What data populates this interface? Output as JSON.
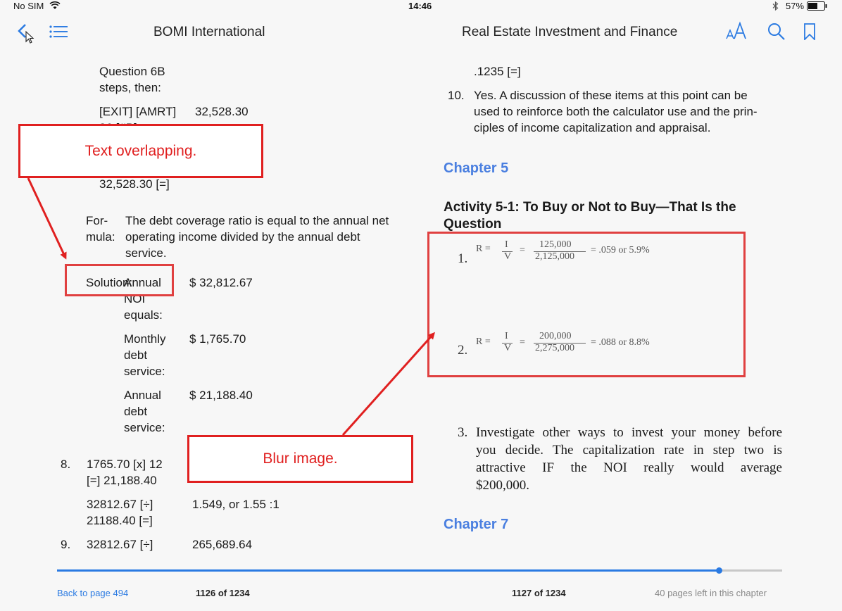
{
  "status_bar": {
    "carrier": "No SIM",
    "time": "14:46",
    "battery": "57%"
  },
  "header": {
    "left_title": "BOMI International",
    "right_title": "Real Estate Investment and Finance"
  },
  "left_page": {
    "q6b_line1": "Question 6B",
    "q6b_line2": "steps, then:",
    "exit_amrt": "[EXIT] [AMRT]",
    "exit_amrt_value": "32,528.30",
    "partial_line": "36 [#P]",
    "result_line": "32,528.30 [=]",
    "formula_label1": "For-",
    "formula_label2": "mula:",
    "formula_text1": "The debt coverage ratio is equal to the annual net",
    "formula_text2": "operating income divided by the annual debt",
    "formula_text3": "service.",
    "solution_label": "Solution:",
    "annual_noi_1": "Annual",
    "annual_noi_2": "NOI",
    "annual_noi_3": "equals:",
    "annual_noi_value": "$ 32,812.67",
    "monthly_1": "Monthly",
    "monthly_2": "debt",
    "monthly_3": "service:",
    "monthly_value": "$ 1,765.70",
    "annual_debt_1": "Annual",
    "annual_debt_2": "debt",
    "annual_debt_3": "service:",
    "annual_debt_value": "$ 21,188.40",
    "item8_num": "8.",
    "item8_line1": "1765.70 [x] 12",
    "item8_line2": "[=] 21,188.40",
    "item8b_line1": "32812.67 [÷]",
    "item8b_line2": "21188.40 [=]",
    "item8b_value": "1.549, or 1.55 :1",
    "item9_num": "9.",
    "item9_line1": "32812.67 [÷]",
    "item9_value": "265,689.64"
  },
  "right_page": {
    "top_line": ".1235 [=]",
    "item10_num": "10.",
    "item10_line1": "Yes. A discussion of these items at this point can be",
    "item10_line2": "used to reinforce both the calculator use and the prin-",
    "item10_line3": "ciples of income capitalization and appraisal.",
    "chapter5": "Chapter 5",
    "activity_line1": "Activity 5-1: To Buy or Not to Buy—That Is the",
    "activity_line2": "Question",
    "eq1": {
      "num": "1.",
      "r": "R =",
      "i": "I",
      "v": "V",
      "eq": "=",
      "numer": "125,000",
      "denom": "2,125,000",
      "result": "= .059 or 5.9%"
    },
    "eq2": {
      "num": "2.",
      "r": "R =",
      "i": "I",
      "v": "V",
      "eq": "=",
      "numer": "200,000",
      "denom": "2,275,000",
      "result": "= .088 or 8.8%"
    },
    "item3_num": "3.",
    "item3_line1": "Investigate other ways to invest your money before",
    "item3_line2": "you decide. The capitalization rate in step two is",
    "item3_line3": "attractive IF the NOI really would average",
    "item3_line4": "$200,000.",
    "chapter7": "Chapter 7"
  },
  "annotations": {
    "overlap": "Text overlapping.",
    "blur": "Blur image."
  },
  "footer": {
    "back_link": "Back to page 494",
    "left_page_num": "1126 of 1234",
    "right_page_num": "1127 of 1234",
    "pages_left": "40 pages left in this chapter",
    "progress": 0.913
  },
  "colors": {
    "accent": "#2a7ae2",
    "annotation": "#e02020",
    "chapter": "#4a7fe0"
  }
}
